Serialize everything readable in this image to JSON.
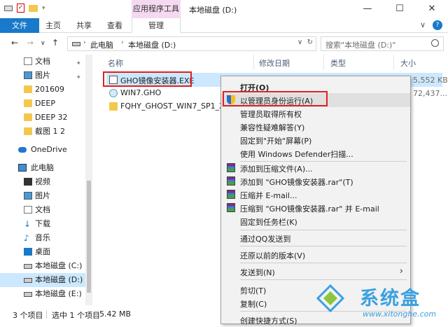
{
  "window": {
    "title": "本地磁盘 (D:)",
    "context_tab": "应用程序工具",
    "controls": [
      "—",
      "☐",
      "✕"
    ]
  },
  "ribbon": {
    "tabs": [
      "文件",
      "主页",
      "共享",
      "查看",
      "管理"
    ],
    "expand_glyph": "∨",
    "help_glyph": "?"
  },
  "nav": {
    "back": "←",
    "forward": "→",
    "dropdown": "∨",
    "up": "↑",
    "breadcrumbs": [
      "此电脑",
      "本地磁盘 (D:)"
    ],
    "refresh": "↻",
    "search_placeholder": "搜索\"本地磁盘 (D:)\""
  },
  "sidebar": {
    "items": [
      {
        "label": "文档",
        "icon": "document-icon",
        "pinned": true
      },
      {
        "label": "图片",
        "icon": "picture-icon",
        "pinned": true
      },
      {
        "label": "201609",
        "icon": "folder-icon"
      },
      {
        "label": "DEEP",
        "icon": "folder-icon"
      },
      {
        "label": "DEEP 32",
        "icon": "folder-icon"
      },
      {
        "label": "截图 1 2",
        "icon": "folder-icon"
      },
      {
        "label": "OneDrive",
        "icon": "onedrive-icon"
      },
      {
        "label": "此电脑",
        "icon": "computer-icon"
      },
      {
        "label": "视频",
        "icon": "video-icon"
      },
      {
        "label": "图片",
        "icon": "picture-icon"
      },
      {
        "label": "文档",
        "icon": "document-icon"
      },
      {
        "label": "下载",
        "icon": "download-icon"
      },
      {
        "label": "音乐",
        "icon": "music-icon"
      },
      {
        "label": "桌面",
        "icon": "desktop-icon"
      },
      {
        "label": "本地磁盘 (C:)",
        "icon": "drive-icon"
      },
      {
        "label": "本地磁盘 (D:)",
        "icon": "drive-icon",
        "selected": true
      },
      {
        "label": "本地磁盘 (E:)",
        "icon": "drive-icon"
      }
    ]
  },
  "columns": [
    "名称",
    "修改日期",
    "类型",
    "大小"
  ],
  "files": [
    {
      "name": "GHO镜像安装器.EXE",
      "icon": "exe-icon",
      "selected": true
    },
    {
      "name": "WIN7.GHO",
      "icon": "gho-icon"
    },
    {
      "name": "FQHY_GHOST_WIN7_SP1_X64",
      "icon": "folder-icon"
    }
  ],
  "sizes_visible": [
    "5,552 KB",
    "72,437..."
  ],
  "context_menu": {
    "items": [
      {
        "label": "打开(O)",
        "bold": true
      },
      {
        "label": "以管理员身份运行(A)",
        "icon": "uac-shield-icon",
        "highlighted": true
      },
      {
        "label": "管理员取得所有权"
      },
      {
        "label": "兼容性疑难解答(Y)"
      },
      {
        "label": "固定到\"开始\"屏幕(P)"
      },
      {
        "label": "使用 Windows Defender扫描..."
      },
      {
        "label": "添加到压缩文件(A)...",
        "icon": "winrar-icon"
      },
      {
        "label": "添加到 \"GHO镜像安装器.rar\"(T)",
        "icon": "winrar-icon"
      },
      {
        "label": "压缩并 E-mail...",
        "icon": "winrar-icon"
      },
      {
        "label": "压缩到 \"GHO镜像安装器.rar\" 并 E-mail",
        "icon": "winrar-icon"
      },
      {
        "label": "固定到任务栏(K)"
      },
      {
        "label": "通过QQ发送到"
      },
      {
        "label": "还原以前的版本(V)"
      },
      {
        "label": "发送到(N)",
        "submenu": true
      },
      {
        "label": "剪切(T)"
      },
      {
        "label": "复制(C)"
      },
      {
        "label": "创建快捷方式(S)"
      }
    ],
    "submenu_glyph": "›"
  },
  "status": {
    "item_count": "3 个项目",
    "selected": "选中 1 个项目",
    "size": "5.42 MB"
  },
  "watermark": {
    "title": "系统盒",
    "url": "www.xitonghe.com"
  },
  "colors": {
    "file_tab": "#1979ca",
    "selection": "#cce8ff",
    "context_tab": "#f5d9f0",
    "highlight_box": "#e02020",
    "watermark": "#3ba0e0"
  }
}
